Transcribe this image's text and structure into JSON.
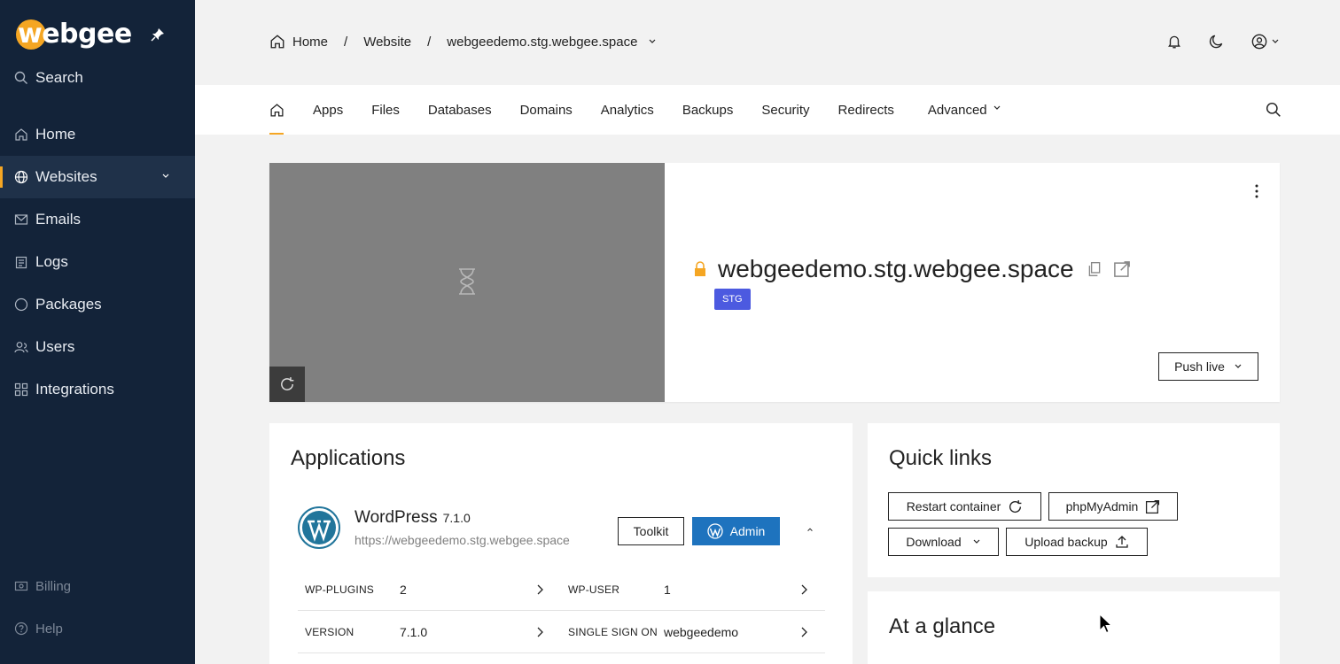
{
  "sidebar": {
    "logo": "webgee",
    "search": "Search",
    "items": [
      {
        "label": "Home"
      },
      {
        "label": "Websites"
      },
      {
        "label": "Emails"
      },
      {
        "label": "Logs"
      },
      {
        "label": "Packages"
      },
      {
        "label": "Users"
      },
      {
        "label": "Integrations"
      }
    ],
    "bottom": [
      {
        "label": "Billing"
      },
      {
        "label": "Help"
      }
    ]
  },
  "breadcrumb": {
    "home": "Home",
    "sep1": "/",
    "website": "Website",
    "sep2": "/",
    "site": "webgeedemo.stg.webgee.space"
  },
  "tabs": [
    "Apps",
    "Files",
    "Databases",
    "Domains",
    "Analytics",
    "Backups",
    "Security",
    "Redirects",
    "Advanced"
  ],
  "site": {
    "domain": "webgeedemo.stg.webgee.space",
    "badge": "STG",
    "push_live": "Push live"
  },
  "applications": {
    "title": "Applications",
    "app_name": "WordPress",
    "app_version": "7.1.0",
    "app_url": "https://webgeedemo.stg.webgee.space",
    "toolkit": "Toolkit",
    "admin": "Admin",
    "rows": [
      {
        "l1": "WP-PLUGINS",
        "v1": "2",
        "l2": "WP-USER",
        "v2": "1"
      },
      {
        "l1": "VERSION",
        "v1": "7.1.0",
        "l2": "SINGLE SIGN ON",
        "v2": "webgeedemo"
      }
    ]
  },
  "quick_links": {
    "title": "Quick links",
    "restart": "Restart container",
    "phpmyadmin": "phpMyAdmin",
    "download": "Download",
    "upload": "Upload backup"
  },
  "glance": {
    "title": "At a glance"
  },
  "colors": {
    "sidebar_bg": "#132339",
    "accent": "#f5a623",
    "stg_badge": "#4c5ae0",
    "wp_admin": "#1e73be"
  }
}
